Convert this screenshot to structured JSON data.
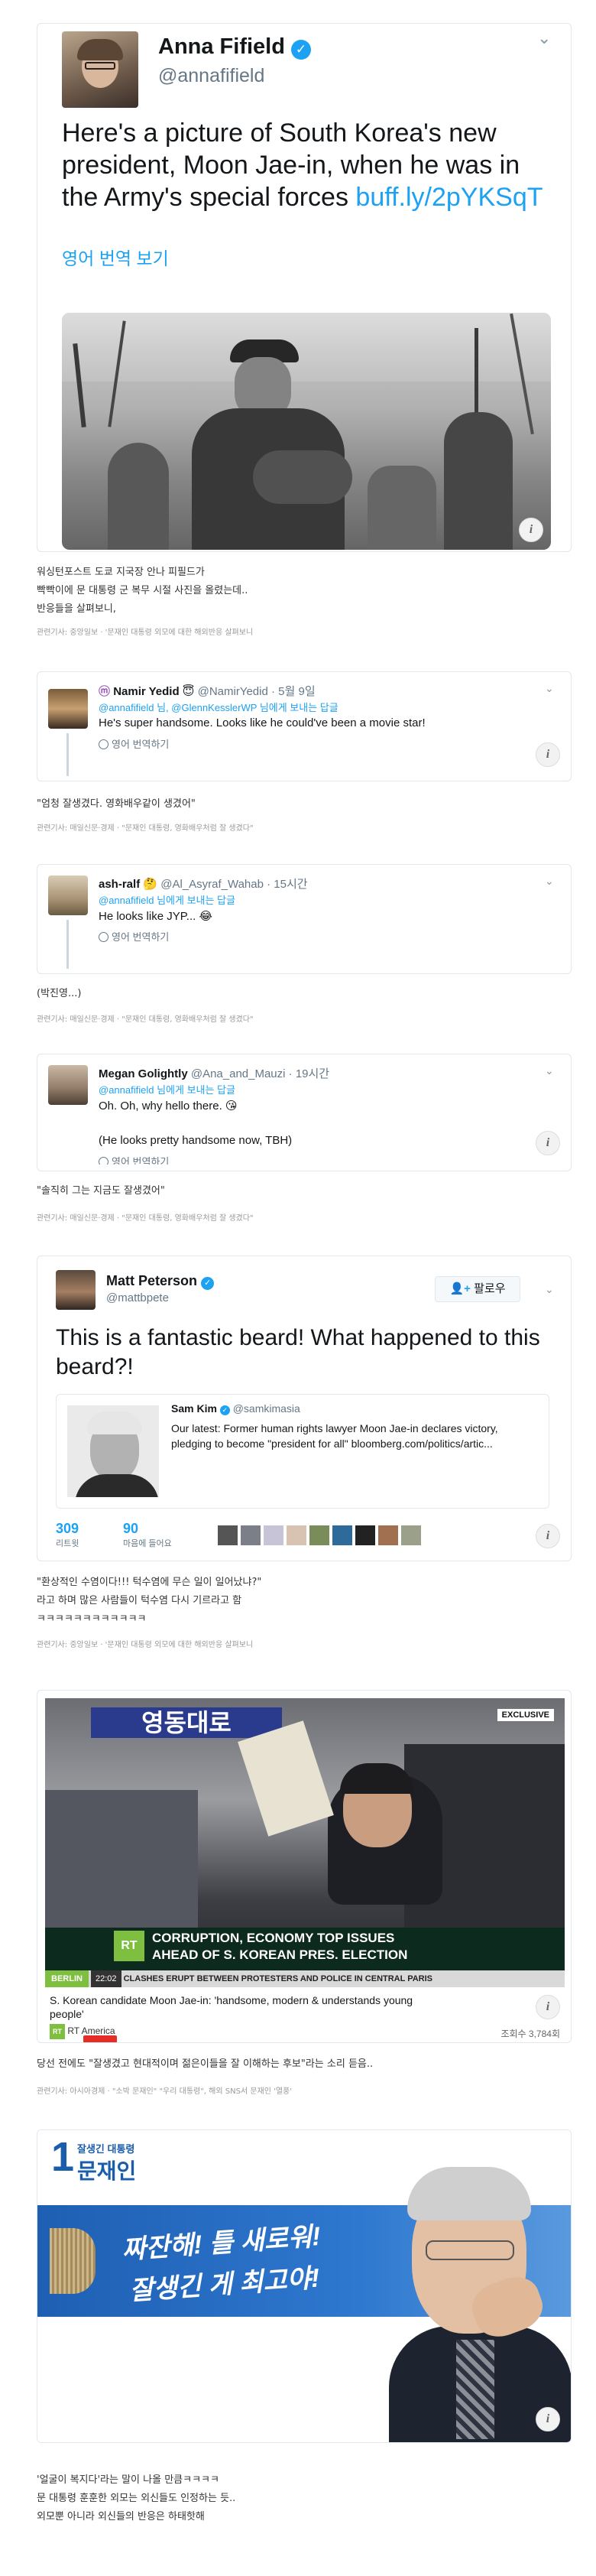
{
  "tweet1": {
    "name": "Anna Fifield",
    "handle": "@annafifield",
    "text": "Here's a picture of South Korea's new president, Moon Jae-in, when he was in the Army's special forces",
    "link": "buff.ly/2pYKSqT",
    "translate": "영어 번역 보기"
  },
  "caption1": {
    "lines": [
      "워싱턴포스트 도쿄 지국장 안나 피필드가",
      "빡빡이에 문 대통령 군 복무 시절 사진을 올렸는데..",
      "반응들을 살펴보니,"
    ],
    "related": "관련기사: 중앙일보 · '문재인 대통령 외모에 대한 해외반응 살펴보니"
  },
  "tweet2": {
    "name": "Namir Yedid",
    "handle": "@NamirYedid",
    "time": "· 5월 9일",
    "reply_prefix": "@annafifield 님, @GlennKesslerWP 님에게 보내는 답글",
    "text": "He's super handsome. Looks like he could've been a movie star!",
    "translate": "영어 번역하기"
  },
  "caption2": {
    "text": "\"엄청 잘생겼다. 영화배우같이 생겼어\"",
    "related": "관련기사: 매일신문·경제 · \"문재인 대통령, 영화배우처럼 잘 생겼다\""
  },
  "tweet3": {
    "name": "ash-ralf",
    "handle": "@Al_Asyraf_Wahab",
    "time": "· 15시간",
    "reply_prefix": "@annafifield 님에게 보내는 답글",
    "text": "He looks like JYP...",
    "translate": "영어 번역하기"
  },
  "caption3": {
    "text": "(박진영...)",
    "related": "관련기사: 매일신문·경제 · \"문재인 대통령, 영화배우처럼 잘 생겼다\""
  },
  "tweet4": {
    "name": "Megan Golightly",
    "handle": "@Ana_and_Mauzi",
    "time": "· 19시간",
    "reply_prefix": "@annafifield 님에게 보내는 답글",
    "text1": "Oh. Oh, why hello there.",
    "text2": "(He looks pretty handsome now, TBH)",
    "translate": "영어 번역하기"
  },
  "caption4": {
    "text": "\"솔직히 그는 지금도 잘생겼어\"",
    "related": "관련기사: 매일신문·경제 · \"문재인 대통령, 영화배우처럼 잘 생겼다\""
  },
  "tweet5": {
    "name": "Matt Peterson",
    "handle": "@mattbpete",
    "follow": "팔로우",
    "text": "This is a fantastic beard! What happened to this beard?!",
    "quote_name": "Sam Kim",
    "quote_handle": "@samkimasia",
    "quote_text": "Our latest: Former human rights lawyer Moon Jae-in declares victory, pledging to become \"president for all\" bloomberg.com/politics/artic...",
    "retweets": "309",
    "retweets_label": "리트윗",
    "likes": "90",
    "likes_label": "마음에 들어요"
  },
  "caption5": {
    "lines": [
      "\"환상적인 수염이다!!! 턱수염에 무슨 일이 일어났냐?\"",
      "라고 하며 많은 사람들이 턱수염 다시 기르라고 함",
      "ㅋㅋㅋㅋㅋㅋㅋㅋㅋㅋㅋㅋ"
    ],
    "related": "관련기사: 중앙일보 · '문재인 대통령 외모에 대한 해외반응 살펴보니"
  },
  "video": {
    "sign": "영동대로",
    "exclusive": "EXCLUSIVE",
    "headline1": "CORRUPTION, ECONOMY TOP ISSUES",
    "headline2": "AHEAD OF S. KOREAN PRES. ELECTION",
    "ticker_city": "BERLIN",
    "ticker_time": "22:02",
    "ticker_text": "CLASHES ERUPT BETWEEN PROTESTERS AND POLICE IN CENTRAL PARIS",
    "title": "S. Korean candidate Moon Jae-in: 'handsome, modern & understands young people'",
    "channel": "RT America",
    "views": "조회수 3,784회"
  },
  "caption6": {
    "text": "당선 전에도 \"잘생겼고 현대적이며 젊은이들을 잘 이해하는 후보\"라는 소리 듣음..",
    "related": "관련기사: 아시아경제 · \"소박 문재인\" \"우리 대통령\", 해외 SNS서 문재인 '열풍'"
  },
  "poster": {
    "badge_num": "1",
    "badge_top": "잘생긴 대통령",
    "badge_name": "문재인",
    "slogan1": "짜잔해! 틀 새로워!",
    "slogan2": "잘생긴 게 최고야!"
  },
  "caption7": {
    "lines": [
      "'얼굴이 복지다'라는 말이 나올 만큼ㅋㅋㅋㅋ",
      "문 대통령 훈훈한 외모는 외신들도 인정하는 듯..",
      "외모뿐 아니라 외신들의 반응은 하태핫해"
    ]
  }
}
